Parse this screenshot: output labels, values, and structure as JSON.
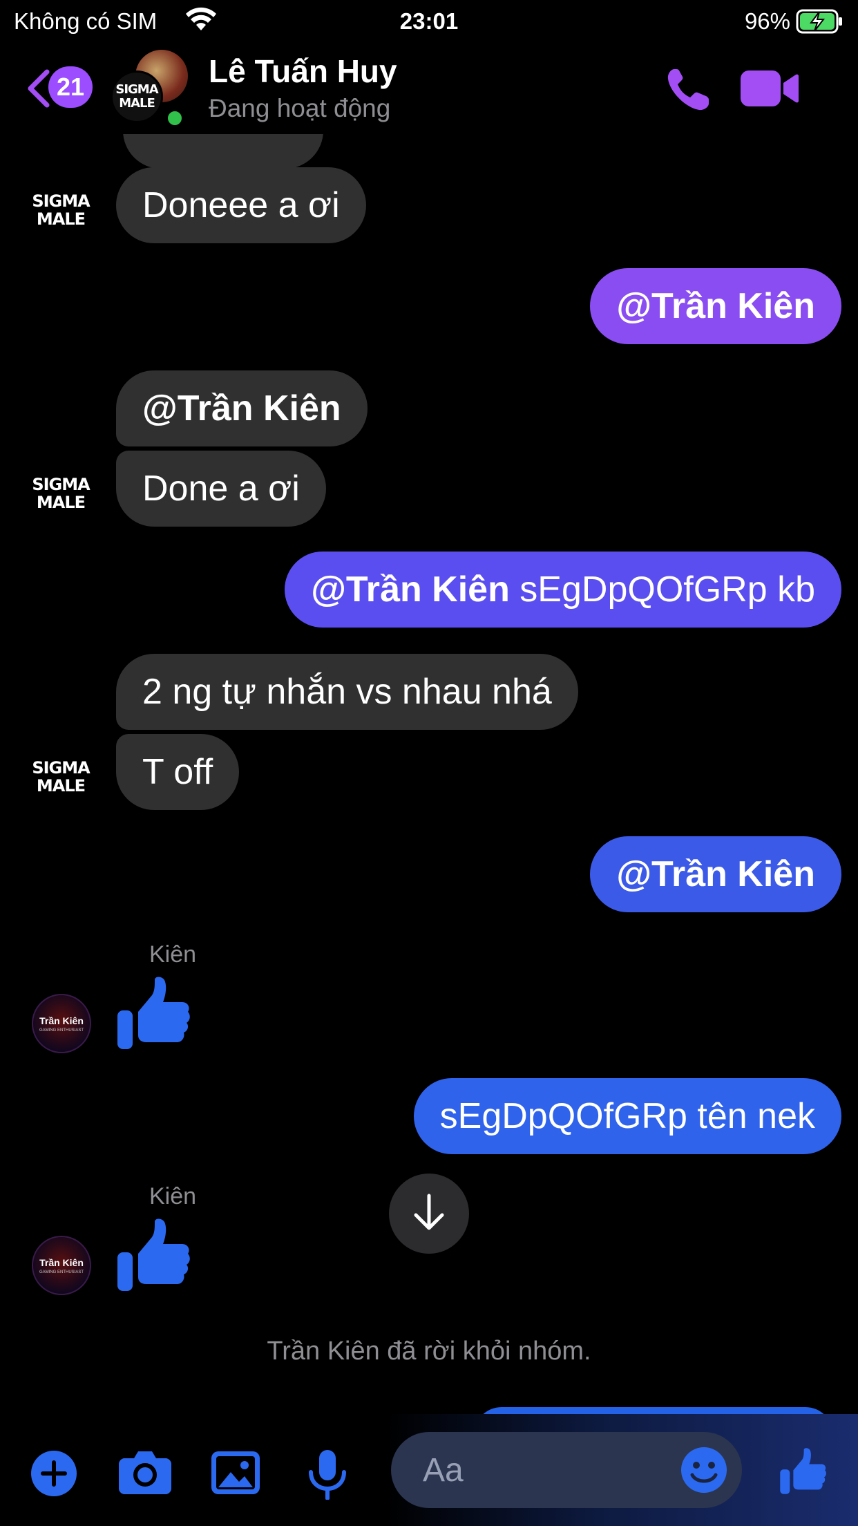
{
  "status_bar": {
    "carrier": "Không có SIM",
    "time": "23:01",
    "battery": "96%"
  },
  "header": {
    "back_count": "21",
    "contact_name": "Lê Tuấn Huy",
    "contact_status": "Đang hoạt động",
    "accent": "#a34df5"
  },
  "avatars": {
    "sigma_line1": "SIGMA",
    "sigma_line2": "MALE",
    "kien_name": "Trần Kiên",
    "kien_sub": "GAMING ENTHUSIAST"
  },
  "messages": [
    {
      "from": "Lê Tuấn Huy",
      "text": "Doneee a ơi"
    },
    {
      "from": "me",
      "mention": "@Trần Kiên",
      "text": ""
    },
    {
      "from": "Lê Tuấn Huy",
      "mention": "@Trần Kiên",
      "text": ""
    },
    {
      "from": "Lê Tuấn Huy",
      "text": "Done a ơi"
    },
    {
      "from": "me",
      "mention": "@Trần Kiên",
      "text": " sEgDpQOfGRp kb"
    },
    {
      "from": "Lê Tuấn Huy",
      "text": "2 ng tự nhắn vs nhau nhá"
    },
    {
      "from": "Lê Tuấn Huy",
      "text": "T off"
    },
    {
      "from": "me",
      "mention": "@Trần Kiên",
      "text": ""
    },
    {
      "from": "Kiên",
      "sender_label": "Kiên",
      "type": "like"
    },
    {
      "from": "me",
      "text": "sEgDpQOfGRp tên nek"
    },
    {
      "from": "Kiên",
      "sender_label": "Kiên",
      "type": "like"
    }
  ],
  "system_message": "Trần Kiên đã rời khỏi nhóm.",
  "composer": {
    "placeholder": "Aa"
  },
  "colors": {
    "bubble_incoming": "#303030",
    "bubble_purple": "#8a4df2",
    "bubble_indigo": "#5b4ef0",
    "bubble_blue": "#3c5ae8",
    "bubble_blue2": "#2f63ec",
    "like_blue": "#2b6af0",
    "online": "#31c04a"
  }
}
